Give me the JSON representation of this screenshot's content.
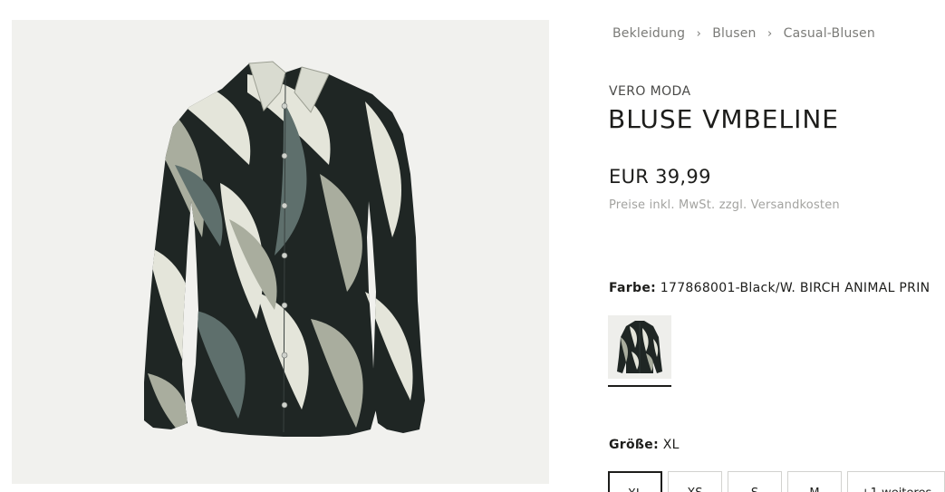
{
  "breadcrumb": {
    "items": [
      "Bekleidung",
      "Blusen",
      "Casual-Blusen"
    ]
  },
  "product": {
    "brand": "VERO MODA",
    "title": "BLUSE VMBELINE",
    "price": "EUR 39,99",
    "price_note": "Preise inkl. MwSt. zzgl. Versandkosten"
  },
  "color": {
    "label": "Farbe:",
    "value": "177868001-Black/W. BIRCH ANIMAL PRIN"
  },
  "size": {
    "label": "Größe:",
    "value": "XL",
    "options": [
      "XL",
      "XS",
      "S",
      "M",
      "+1 weiteres"
    ],
    "selected_index": 0
  },
  "colors": {
    "text": "#1d1d1b",
    "muted": "#7b7b78",
    "image_bg": "#f1f1ee",
    "print_dark": "#1f2624",
    "print_teal": "#5e6f6c",
    "print_sage": "#a9ad9e",
    "print_cream": "#e4e5da"
  },
  "icons": {
    "breadcrumb_separator": "chevron-right-icon"
  }
}
